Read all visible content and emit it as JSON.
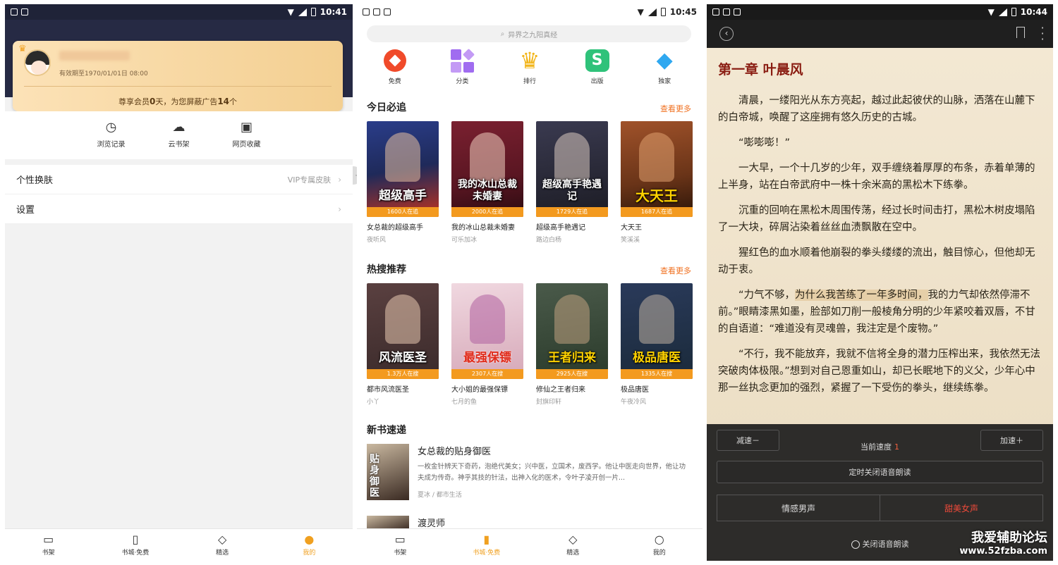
{
  "status": {
    "p1_time": "10:41",
    "p2_time": "10:45",
    "p3_time": "10:44"
  },
  "profile": {
    "expire": "有效期至1970/01/01日 08:00",
    "vip_prefix": "尊享会员",
    "vip_days": "0",
    "vip_mid": "天，为您屏蔽广告",
    "vip_ads": "14",
    "vip_suffix": "个",
    "shortcuts": [
      {
        "label": "浏览记录",
        "icon": "clock-icon"
      },
      {
        "label": "云书架",
        "icon": "cloud-icon"
      },
      {
        "label": "网页收藏",
        "icon": "bookmark-folder-icon"
      }
    ],
    "menu": [
      {
        "label": "个性换肤",
        "value": "VIP专属皮肤"
      },
      {
        "label": "设置",
        "value": ""
      }
    ]
  },
  "tabs_p1": [
    {
      "label": "书架",
      "icon": "book-open-icon"
    },
    {
      "label": "书城·免费",
      "icon": "book-icon"
    },
    {
      "label": "精选",
      "icon": "diamond-icon"
    },
    {
      "label": "我的",
      "icon": "person-icon"
    }
  ],
  "tabs_p2": [
    {
      "label": "书架",
      "icon": "book-open-icon"
    },
    {
      "label": "书城·免费",
      "icon": "book-icon"
    },
    {
      "label": "精选",
      "icon": "diamond-icon"
    },
    {
      "label": "我的",
      "icon": "person-icon"
    }
  ],
  "store": {
    "search_placeholder": "异界之九阳真经",
    "categories": [
      {
        "label": "免费",
        "color": "#f04a2a"
      },
      {
        "label": "分类",
        "color": "#a06cf0"
      },
      {
        "label": "排行",
        "color": "#f2b51a"
      },
      {
        "label": "出版",
        "color": "#2fc27a"
      },
      {
        "label": "独家",
        "color": "#2fa8f0"
      }
    ],
    "sections": [
      {
        "title": "今日必追",
        "more": "查看更多",
        "books": [
          {
            "cover_title": "超级高手",
            "badge": "1600人在追",
            "name": "女总裁的超级高手",
            "author": "夜听风",
            "bg": "#1f2a5a"
          },
          {
            "cover_title": "我的冰山总裁未婚妻",
            "badge": "2000人在追",
            "name": "我的冰山总裁未婚妻",
            "author": "可乐加冰",
            "bg": "#5a1622"
          },
          {
            "cover_title": "超级高手艳遇记",
            "badge": "1729人在追",
            "name": "超级高手艳遇记",
            "author": "路边白杨",
            "bg": "#1c1c24"
          },
          {
            "cover_title": "大天王",
            "badge": "1687人在追",
            "name": "大天王",
            "author": "笑溪溪",
            "bg": "#6a3418"
          }
        ]
      },
      {
        "title": "热搜推荐",
        "more": "查看更多",
        "books": [
          {
            "cover_title": "风流医圣",
            "badge": "1.3万人在搜",
            "name": "都市风流医圣",
            "author": "小丫",
            "bg": "#3a2a2a"
          },
          {
            "cover_title": "最强保镖",
            "badge": "2307人在搜",
            "name": "大小姐的最强保镖",
            "author": "七月的鱼",
            "bg": "#d6a8b8"
          },
          {
            "cover_title": "王者归来",
            "badge": "2925人在搜",
            "name": "修仙之王者归来",
            "author": "封旗印轩",
            "bg": "#2a3a2a"
          },
          {
            "cover_title": "极品唐医",
            "badge": "1335人在搜",
            "name": "极品唐医",
            "author": "午夜冷风",
            "bg": "#1a2a3a"
          }
        ]
      }
    ],
    "new_title": "新书速递",
    "new_books": [
      {
        "cover_title": "贴身御医",
        "name": "女总裁的贴身御医",
        "desc": "一枚金针辨天下奇药，泡绝代美女；兴中医，立国术，废西学。他让中医走向世界，他让功夫成为传奇。神乎其技的针法，出神入化的医术，令叶子凌开创一片...",
        "author": "夏冰",
        "genre": "都市生活"
      },
      {
        "name": "渡灵师"
      }
    ]
  },
  "reader": {
    "chapter": "第一章 叶晨风",
    "paragraphs": [
      "清晨，一缕阳光从东方亮起，越过此起彼伏的山脉，洒落在山麓下的白帝城，唤醒了这座拥有悠久历史的古城。",
      "“嘭嘭嘭！”",
      "一大早，一个十几岁的少年，双手缠绕着厚厚的布条，赤着单薄的上半身，站在白帝武府中一株十余米高的黑松木下练拳。",
      "沉重的回响在黑松木周围传荡，经过长时间击打，黑松木树皮塌陷了一大块，碎屑沾染着丝丝血渍飘散在空中。",
      "猩红色的血水顺着他崩裂的拳头缕缕的流出，触目惊心，但他却无动于衷。"
    ],
    "p6_before": "“力气不够，",
    "p6_highlight": "为什么我苦练了一年多时间，",
    "p6_after": "我的力气却依然停滞不前。”眼睛漆黑如墨，脸部如刀削一般棱角分明的少年紧咬着双唇，不甘的自语道：“难道没有灵魂兽，我注定是个废物。”",
    "p7": "“不行，我不能放弃，我就不信将全身的潜力压榨出来，我依然无法突破肉体极限。”想到对自己恩重如山，却已长眠地下的义父，少年心中那一丝执念更加的强烈，紧握了一下受伤的拳头，继续练拳。",
    "tts": {
      "slower": "减速－",
      "speed_label": "当前速度",
      "speed_value": "1",
      "faster": "加速＋",
      "timer": "定时关闭语音朗读",
      "voice_male": "情感男声",
      "voice_female": "甜美女声",
      "close": "关闭语音朗读"
    }
  },
  "watermark": {
    "line1": "我爱辅助论坛",
    "line2": "www.52fzba.com"
  }
}
